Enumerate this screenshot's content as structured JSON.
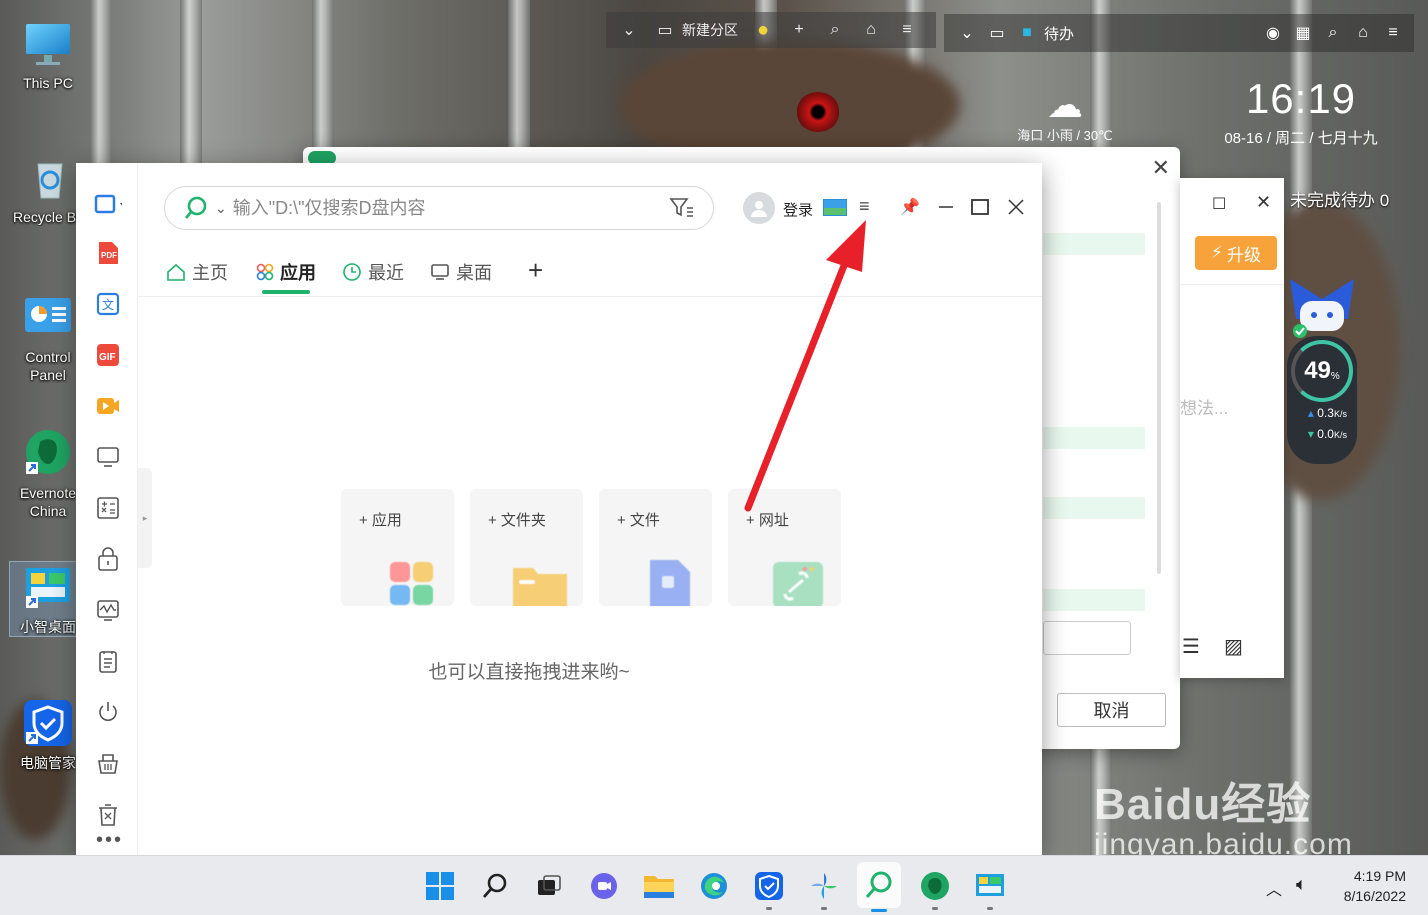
{
  "desktop": {
    "icons": [
      {
        "label": "This PC"
      },
      {
        "label": "Recycle Bin"
      },
      {
        "label": "Control Panel"
      },
      {
        "label": "Evernote China"
      },
      {
        "label": "小智桌面"
      },
      {
        "label": "电脑管家"
      }
    ]
  },
  "fence_bar": {
    "title": "新建分区"
  },
  "todo_bar": {
    "title": "待办"
  },
  "clock": {
    "time": "16:19",
    "date": "08-16 / 周二 / 七月十九"
  },
  "weather": {
    "text": "海口 小雨 / 30℃"
  },
  "side_panel": {
    "pending_label": "未完成待办 0",
    "upgrade_label": "升级",
    "placeholder_fragment": "想法..."
  },
  "speed_widget": {
    "percent": "49",
    "unit": "%",
    "upload": "0.3",
    "download": "0.0",
    "rate_unit": "K/s"
  },
  "bg_dialog": {
    "cancel_label": "取消"
  },
  "main_window": {
    "search_placeholder": "输入\"D:\\\"仅搜索D盘内容",
    "login_label": "登录",
    "tabs": [
      {
        "label": "主页"
      },
      {
        "label": "应用"
      },
      {
        "label": "最近"
      },
      {
        "label": "桌面"
      }
    ],
    "add_cards": [
      {
        "label": "+ 应用"
      },
      {
        "label": "+ 文件夹"
      },
      {
        "label": "+ 文件"
      },
      {
        "label": "+ 网址"
      }
    ],
    "drop_hint": "也可以直接拖拽进来哟~"
  },
  "taskbar": {
    "time": "4:19 PM",
    "date": "8/16/2022"
  },
  "watermark": {
    "brand": "Baidu经验",
    "url": "jingyan.baidu.com"
  },
  "colors": {
    "accent": "#1fb46b",
    "arrow": "#e8202a",
    "upgrade": "#f7a23a"
  }
}
